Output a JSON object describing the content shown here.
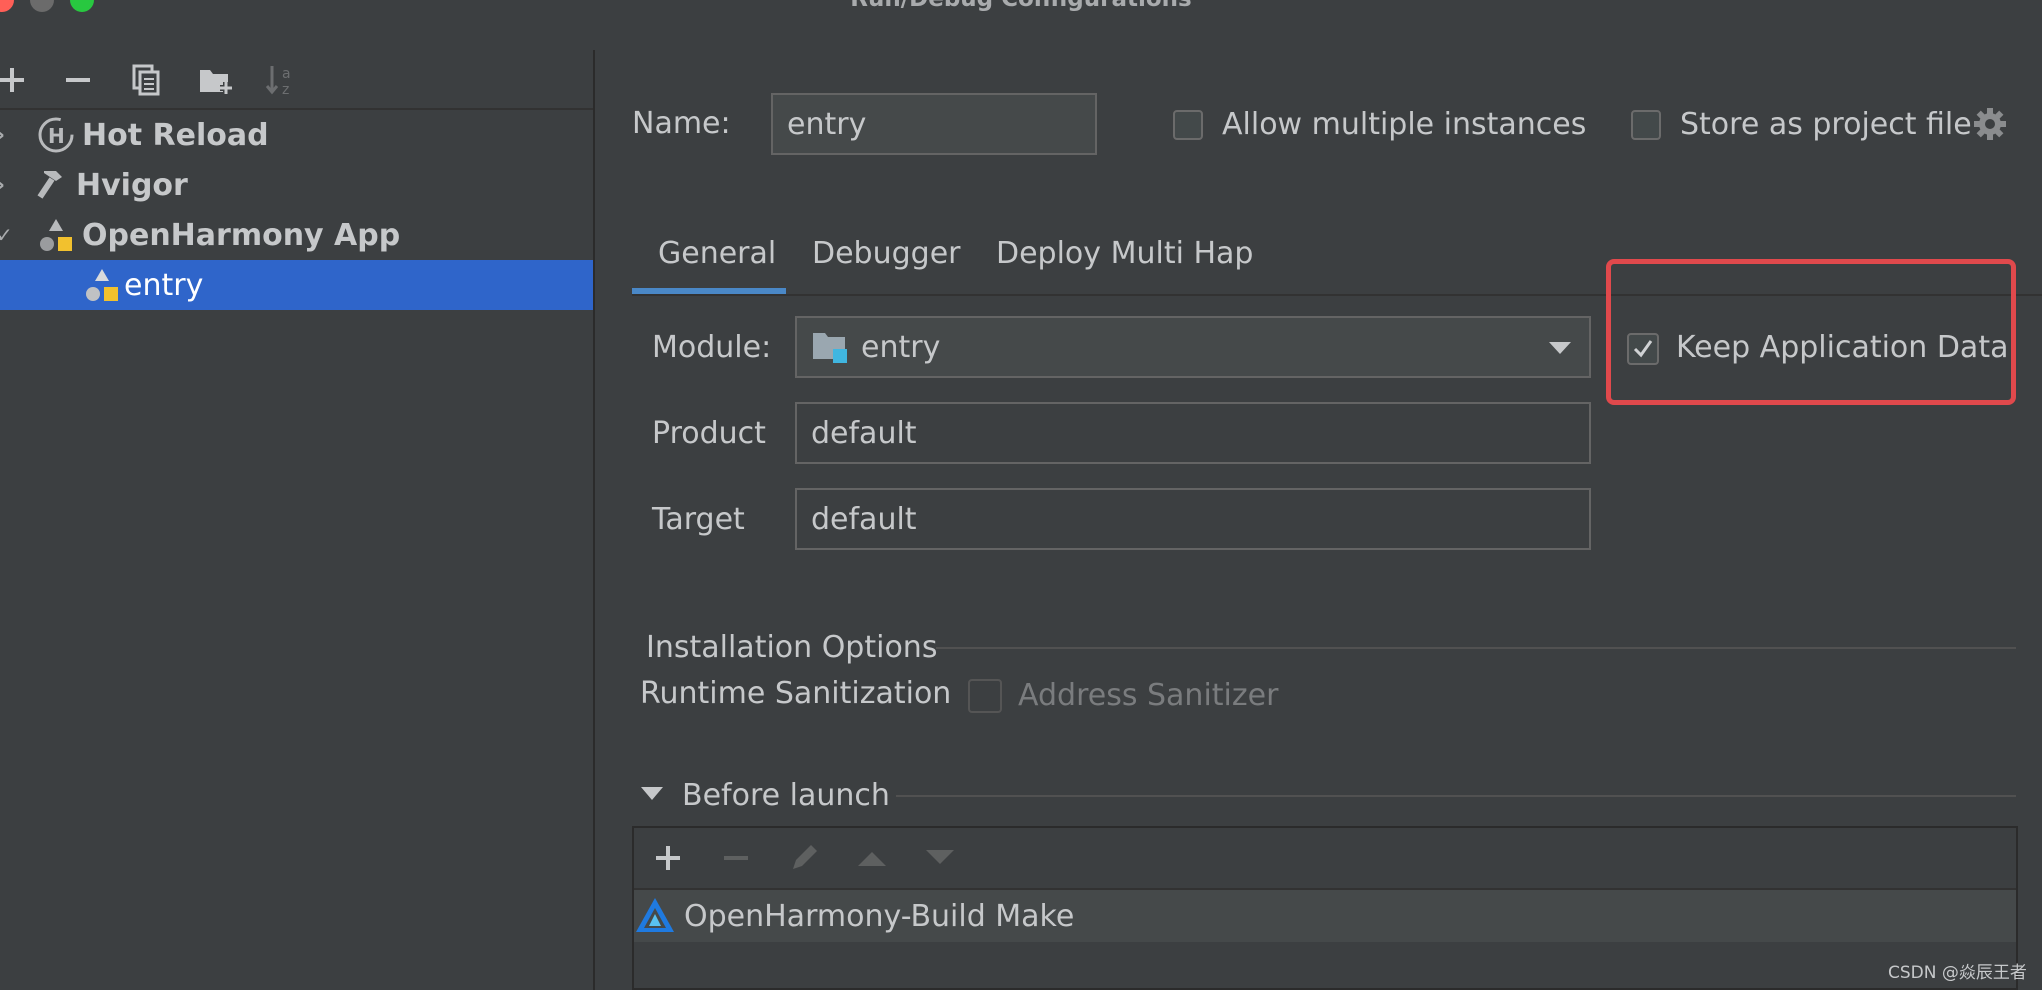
{
  "window": {
    "title": "Run/Debug Configurations"
  },
  "colors": {
    "selection": "#2f65ca",
    "highlight_box": "#e0494c",
    "close": "#ff5f57",
    "minimize": "#6b6b6b",
    "maximize": "#28c840"
  },
  "left_toolbar": {
    "icons": [
      "add-icon",
      "remove-icon",
      "copy-icon",
      "new-folder-icon",
      "sort-icon"
    ]
  },
  "tree": [
    {
      "label": "Hot Reload",
      "icon": "hot-reload-icon"
    },
    {
      "label": "Hvigor",
      "icon": "hammer-icon"
    },
    {
      "label": "OpenHarmony App",
      "icon": "shapes-icon"
    },
    {
      "label": "entry",
      "icon": "shapes-icon",
      "selected": true
    }
  ],
  "name_row": {
    "label": "Name:",
    "value": "entry",
    "allow_multiple_label": "Allow multiple instances",
    "allow_multiple_checked": false,
    "store_project_label": "Store as project file",
    "store_project_checked": false
  },
  "tabs": [
    "General",
    "Debugger",
    "Deploy Multi Hap"
  ],
  "active_tab": "General",
  "general": {
    "module_label": "Module:",
    "module_value": "entry",
    "product_label": "Product",
    "product_value": "default",
    "target_label": "Target",
    "target_value": "default",
    "keep_data_label": "Keep Application Data",
    "keep_data_checked": true
  },
  "installation": {
    "header": "Installation Options",
    "runtime_label": "Runtime Sanitization",
    "address_sanitizer_label": "Address Sanitizer",
    "address_sanitizer_checked": false
  },
  "before_launch": {
    "header": "Before launch",
    "items": [
      "OpenHarmony-Build Make"
    ]
  },
  "watermark": "CSDN @焱辰王者"
}
